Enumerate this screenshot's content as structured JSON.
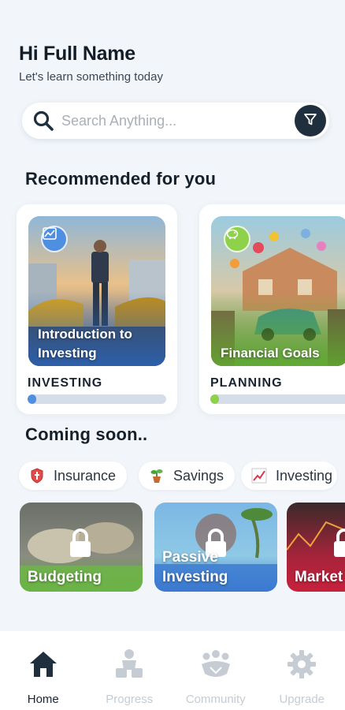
{
  "greeting": {
    "title": "Hi Full Name",
    "subtitle": "Let's learn something today"
  },
  "search": {
    "placeholder": "Search Anything..."
  },
  "recommended": {
    "heading": "Recommended for you",
    "cards": [
      {
        "title": "Introduction to Investing",
        "category": "INVESTING",
        "progress": 0.06,
        "accent": "#4f8fe0",
        "icon": "chart-icon"
      },
      {
        "title": "Financial Goals",
        "category": "PLANNING",
        "progress": 0.06,
        "accent": "#8ed14a",
        "icon": "piggy-bank-icon"
      }
    ]
  },
  "coming_soon": {
    "heading": "Coming soon..",
    "chips": [
      {
        "label": "Insurance",
        "icon": "shield-icon"
      },
      {
        "label": "Savings",
        "icon": "plant-pot-icon"
      },
      {
        "label": "Investing",
        "icon": "trend-chart-icon"
      }
    ],
    "cards": [
      {
        "title": "Budgeting"
      },
      {
        "title": "Passive Investing"
      },
      {
        "title": "Market"
      }
    ]
  },
  "nav": {
    "items": [
      {
        "label": "Home",
        "icon": "home-icon",
        "active": true
      },
      {
        "label": "Progress",
        "icon": "progress-icon",
        "active": false
      },
      {
        "label": "Community",
        "icon": "community-icon",
        "active": false
      },
      {
        "label": "Upgrade",
        "icon": "gear-icon",
        "active": false
      }
    ]
  },
  "colors": {
    "background": "#f2f6fa",
    "dark": "#1f2f3d",
    "inactive": "#c5ccd4"
  }
}
